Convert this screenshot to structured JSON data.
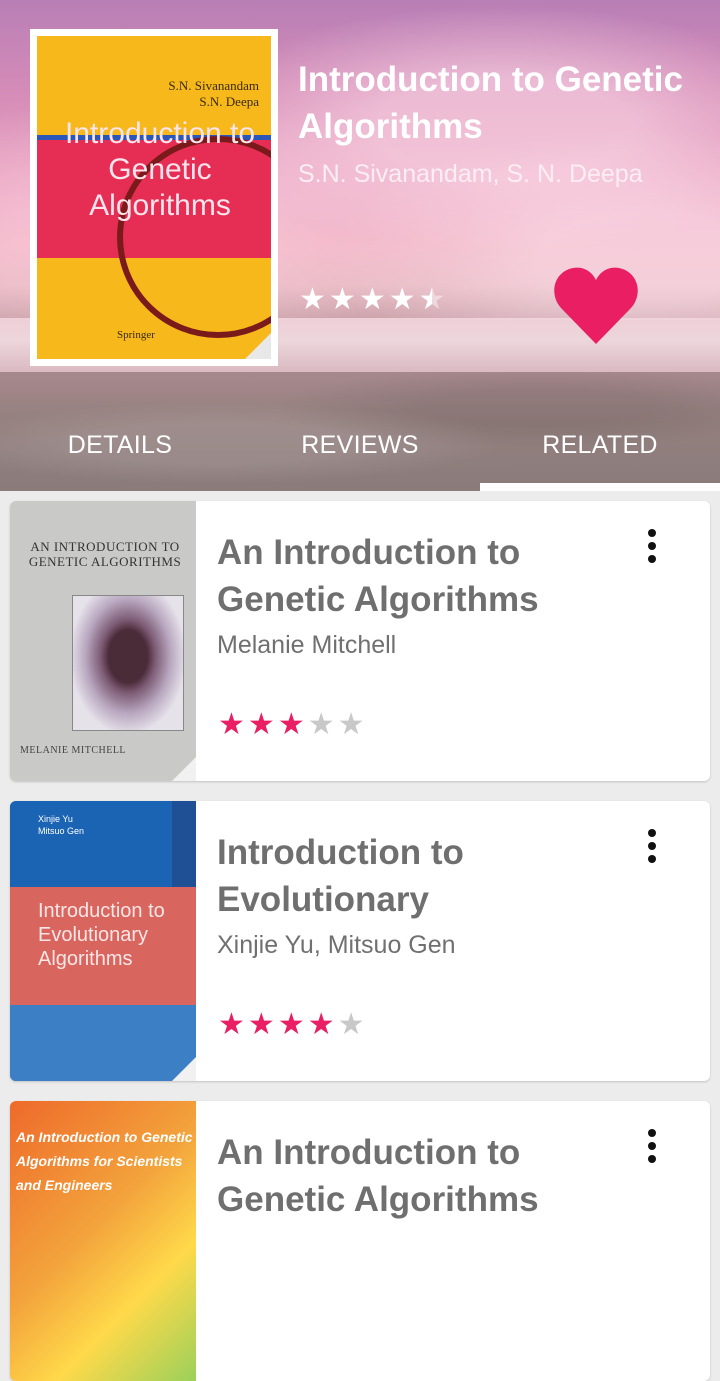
{
  "book": {
    "title": "Introduction to Genetic Algorithms",
    "authors": "S.N. Sivanandam, S. N. Deepa",
    "rating": 4.5,
    "favorite": true,
    "cover": {
      "author_line1": "S.N. Sivanandam",
      "author_line2": "S.N. Deepa",
      "title": "Introduction to Genetic Algorithms",
      "publisher": "Springer"
    }
  },
  "tabs": [
    {
      "label": "DETAILS",
      "selected": false
    },
    {
      "label": "REVIEWS",
      "selected": false
    },
    {
      "label": "RELATED",
      "selected": true
    }
  ],
  "related": [
    {
      "title": "An Introduction to Genetic Algorithms",
      "author": "Melanie Mitchell",
      "rating": 3,
      "cover": {
        "heading": "AN INTRODUCTION TO GENETIC ALGORITHMS",
        "footer": "MELANIE MITCHELL"
      }
    },
    {
      "title": "Introduction to Evolutionary",
      "author": "Xinjie Yu, Mitsuo Gen",
      "rating": 4,
      "cover": {
        "authors": "Xinjie Yu\nMitsuo Gen",
        "title": "Introduction to Evolutionary Algorithms"
      }
    },
    {
      "title": "An Introduction to Genetic Algorithms",
      "author": "",
      "rating": 0,
      "cover": {
        "title": "An Introduction to Genetic Algorithms for Scientists and Engineers"
      }
    }
  ],
  "colors": {
    "accent": "#e91e63",
    "star_off": "#c8c8c8",
    "text_gray": "#6f6f6f"
  },
  "icons": {
    "favorite": "heart-icon",
    "more": "more-vert-icon",
    "star": "star-icon"
  }
}
